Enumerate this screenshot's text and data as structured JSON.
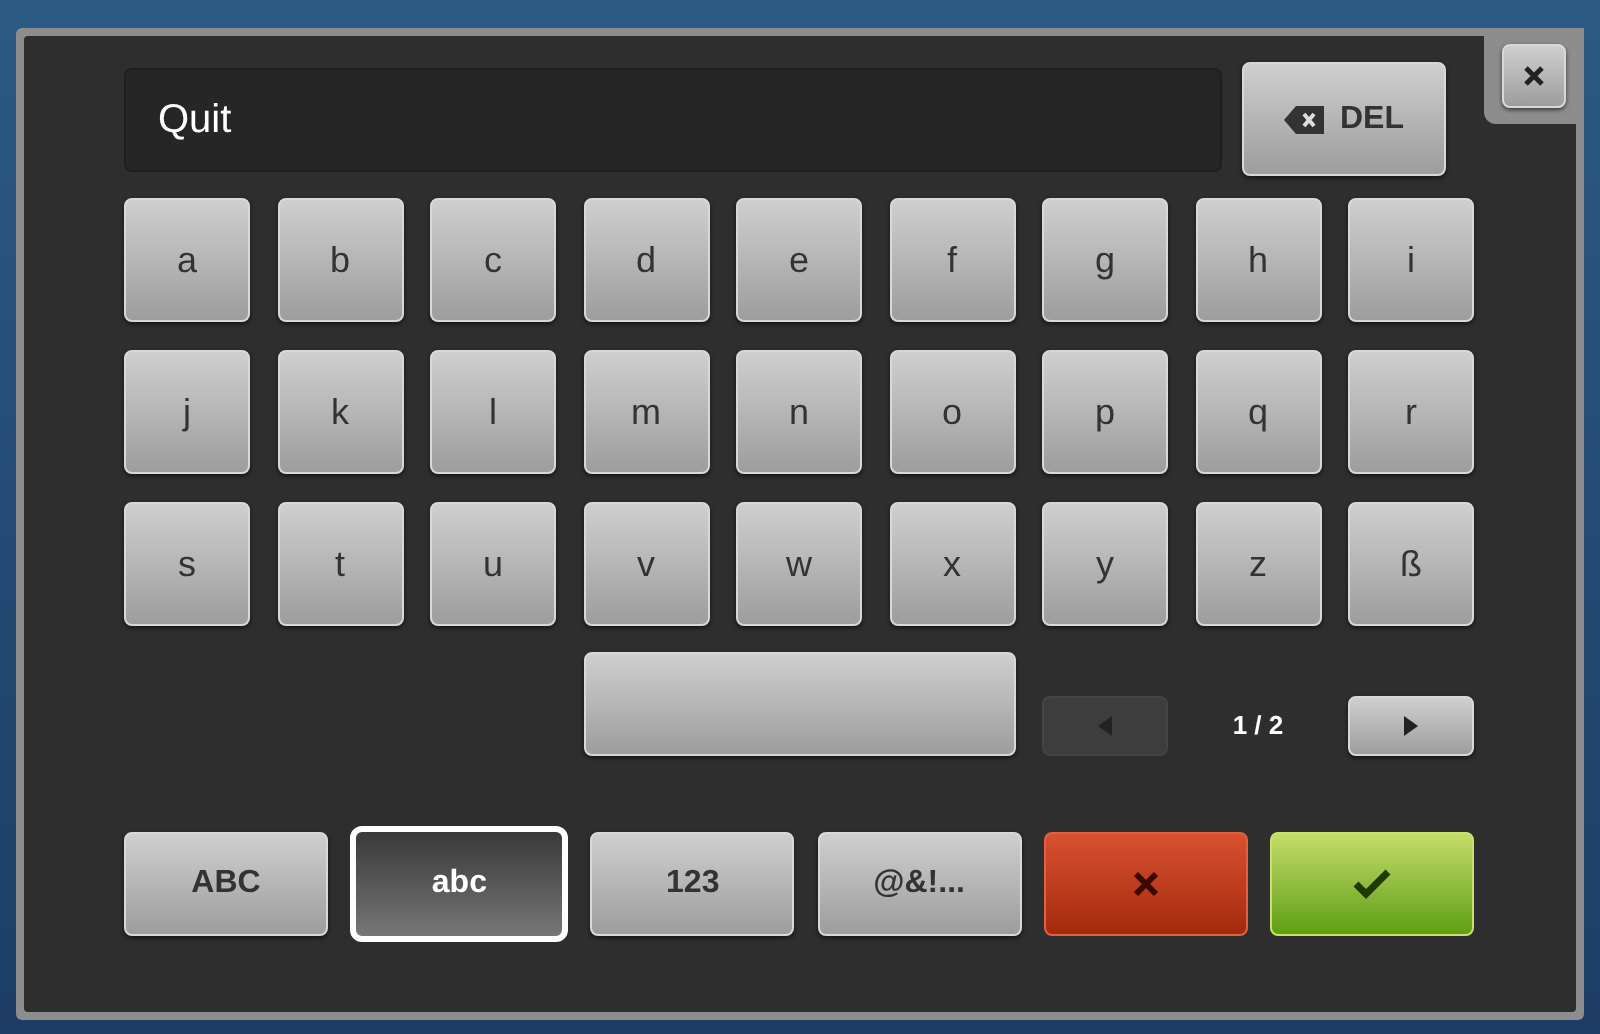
{
  "input": {
    "value": "Quit"
  },
  "delete_button": {
    "label": "DEL"
  },
  "keys": [
    [
      "a",
      "b",
      "c",
      "d",
      "e",
      "f",
      "g",
      "h",
      "i"
    ],
    [
      "j",
      "k",
      "l",
      "m",
      "n",
      "o",
      "p",
      "q",
      "r"
    ],
    [
      "s",
      "t",
      "u",
      "v",
      "w",
      "x",
      "y",
      "z",
      "ß"
    ]
  ],
  "pager": {
    "text": "1 / 2",
    "prev_disabled": true,
    "next_disabled": false
  },
  "modes": [
    {
      "label": "ABC",
      "selected": false
    },
    {
      "label": "abc",
      "selected": true
    },
    {
      "label": "123",
      "selected": false
    },
    {
      "label": "@&!...",
      "selected": false
    }
  ]
}
